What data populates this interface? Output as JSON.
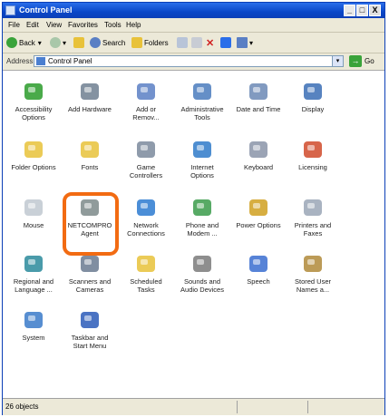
{
  "window": {
    "title": "Control Panel",
    "min": "_",
    "max": "□",
    "close": "X"
  },
  "menu": [
    "File",
    "Edit",
    "View",
    "Favorites",
    "Tools",
    "Help"
  ],
  "toolbar": {
    "back": "Back",
    "search": "Search",
    "folders": "Folders"
  },
  "address": {
    "label": "Address",
    "value": "Control Panel",
    "go": "Go"
  },
  "icons": [
    {
      "label": "Accessibility\nOptions",
      "icon": "accessibility-icon",
      "color": "#2a9b2a"
    },
    {
      "label": "Add Hardware",
      "icon": "add-hardware-icon",
      "color": "#6e7f91"
    },
    {
      "label": "Add or\nRemov...",
      "icon": "add-remove-programs-icon",
      "color": "#5a7fc4"
    },
    {
      "label": "Administrative\nTools",
      "icon": "administrative-tools-icon",
      "color": "#4a7bbd"
    },
    {
      "label": "Date and Time",
      "icon": "date-time-icon",
      "color": "#6b88b5"
    },
    {
      "label": "Display",
      "icon": "display-icon",
      "color": "#3a6db5"
    },
    {
      "label": "Folder Options",
      "icon": "folder-options-icon",
      "color": "#e8c23a"
    },
    {
      "label": "Fonts",
      "icon": "fonts-icon",
      "color": "#e8c23a"
    },
    {
      "label": "Game\nControllers",
      "icon": "game-controllers-icon",
      "color": "#7b8a9c"
    },
    {
      "label": "Internet\nOptions",
      "icon": "internet-options-icon",
      "color": "#2f7ac9"
    },
    {
      "label": "Keyboard",
      "icon": "keyboard-icon",
      "color": "#8a94a8"
    },
    {
      "label": "Licensing",
      "icon": "licensing-icon",
      "color": "#d04a2a"
    },
    {
      "label": "Mouse",
      "icon": "mouse-icon",
      "color": "#c0c8d0"
    },
    {
      "label": "NETCOMPRO\nAgent",
      "icon": "netcompro-agent-icon",
      "color": "#7d8a8a"
    },
    {
      "label": "Network\nConnections",
      "icon": "network-connections-icon",
      "color": "#2b7ad0"
    },
    {
      "label": "Phone and\nModem ...",
      "icon": "phone-modem-icon",
      "color": "#3a9b4a"
    },
    {
      "label": "Power Options",
      "icon": "power-options-icon",
      "color": "#d0a020"
    },
    {
      "label": "Printers and\nFaxes",
      "icon": "printers-faxes-icon",
      "color": "#9aa6b6"
    },
    {
      "label": "Regional and\nLanguage ...",
      "icon": "regional-language-icon",
      "color": "#2a8a9b"
    },
    {
      "label": "Scanners and\nCameras",
      "icon": "scanners-cameras-icon",
      "color": "#6a7a90"
    },
    {
      "label": "Scheduled\nTasks",
      "icon": "scheduled-tasks-icon",
      "color": "#e8c23a"
    },
    {
      "label": "Sounds and\nAudio Devices",
      "icon": "sounds-audio-icon",
      "color": "#7a7a7a"
    },
    {
      "label": "Speech",
      "icon": "speech-icon",
      "color": "#3a6dd0"
    },
    {
      "label": "Stored User\nNames a...",
      "icon": "stored-user-names-icon",
      "color": "#b08a3a"
    },
    {
      "label": "System",
      "icon": "system-icon",
      "color": "#3a7ac9"
    },
    {
      "label": "Taskbar and\nStart Menu",
      "icon": "taskbar-start-menu-icon",
      "color": "#2a5ab8"
    }
  ],
  "status": {
    "objects": "26 objects"
  },
  "colors": {
    "highlight": "#f26b12",
    "titlebar": "#0a47c8"
  }
}
